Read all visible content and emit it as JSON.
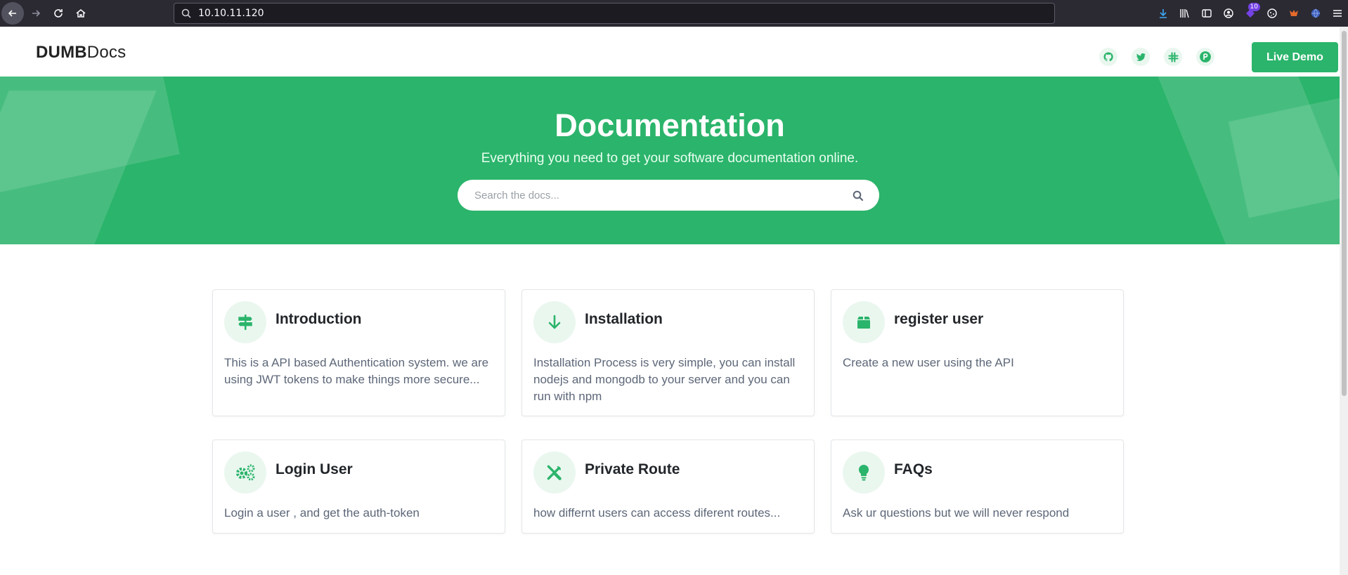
{
  "browser": {
    "url": "10.10.11.120",
    "extension_badge": "10"
  },
  "header": {
    "logo_bold": "DUMB",
    "logo_light": "Docs",
    "social_icons": [
      "github-icon",
      "twitter-icon",
      "slack-icon",
      "product-hunt-icon"
    ],
    "live_demo_label": "Live Demo"
  },
  "hero": {
    "title": "Documentation",
    "subtitle": "Everything you need to get your software documentation online.",
    "search_placeholder": "Search the docs..."
  },
  "cards": [
    {
      "icon": "signpost-icon",
      "title": "Introduction",
      "text": "This is a API based Authentication system. we are using JWT tokens to make things more secure..."
    },
    {
      "icon": "arrow-down-icon",
      "title": "Installation",
      "text": "Installation Process is very simple, you can install nodejs and mongodb to your server and you can run with npm"
    },
    {
      "icon": "box-icon",
      "title": "register user",
      "text": "Create a new user using the API"
    },
    {
      "icon": "cogs-icon",
      "title": "Login User",
      "text": "Login a user , and get the auth-token"
    },
    {
      "icon": "tools-icon",
      "title": "Private Route",
      "text": "how differnt users can access diferent routes..."
    },
    {
      "icon": "lightbulb-icon",
      "title": "FAQs",
      "text": "Ask ur questions but we will never respond"
    }
  ],
  "colors": {
    "brand_green": "#2bb46b",
    "browser_bar": "#2b2a33",
    "card_icon_bg": "#eaf7ef"
  }
}
